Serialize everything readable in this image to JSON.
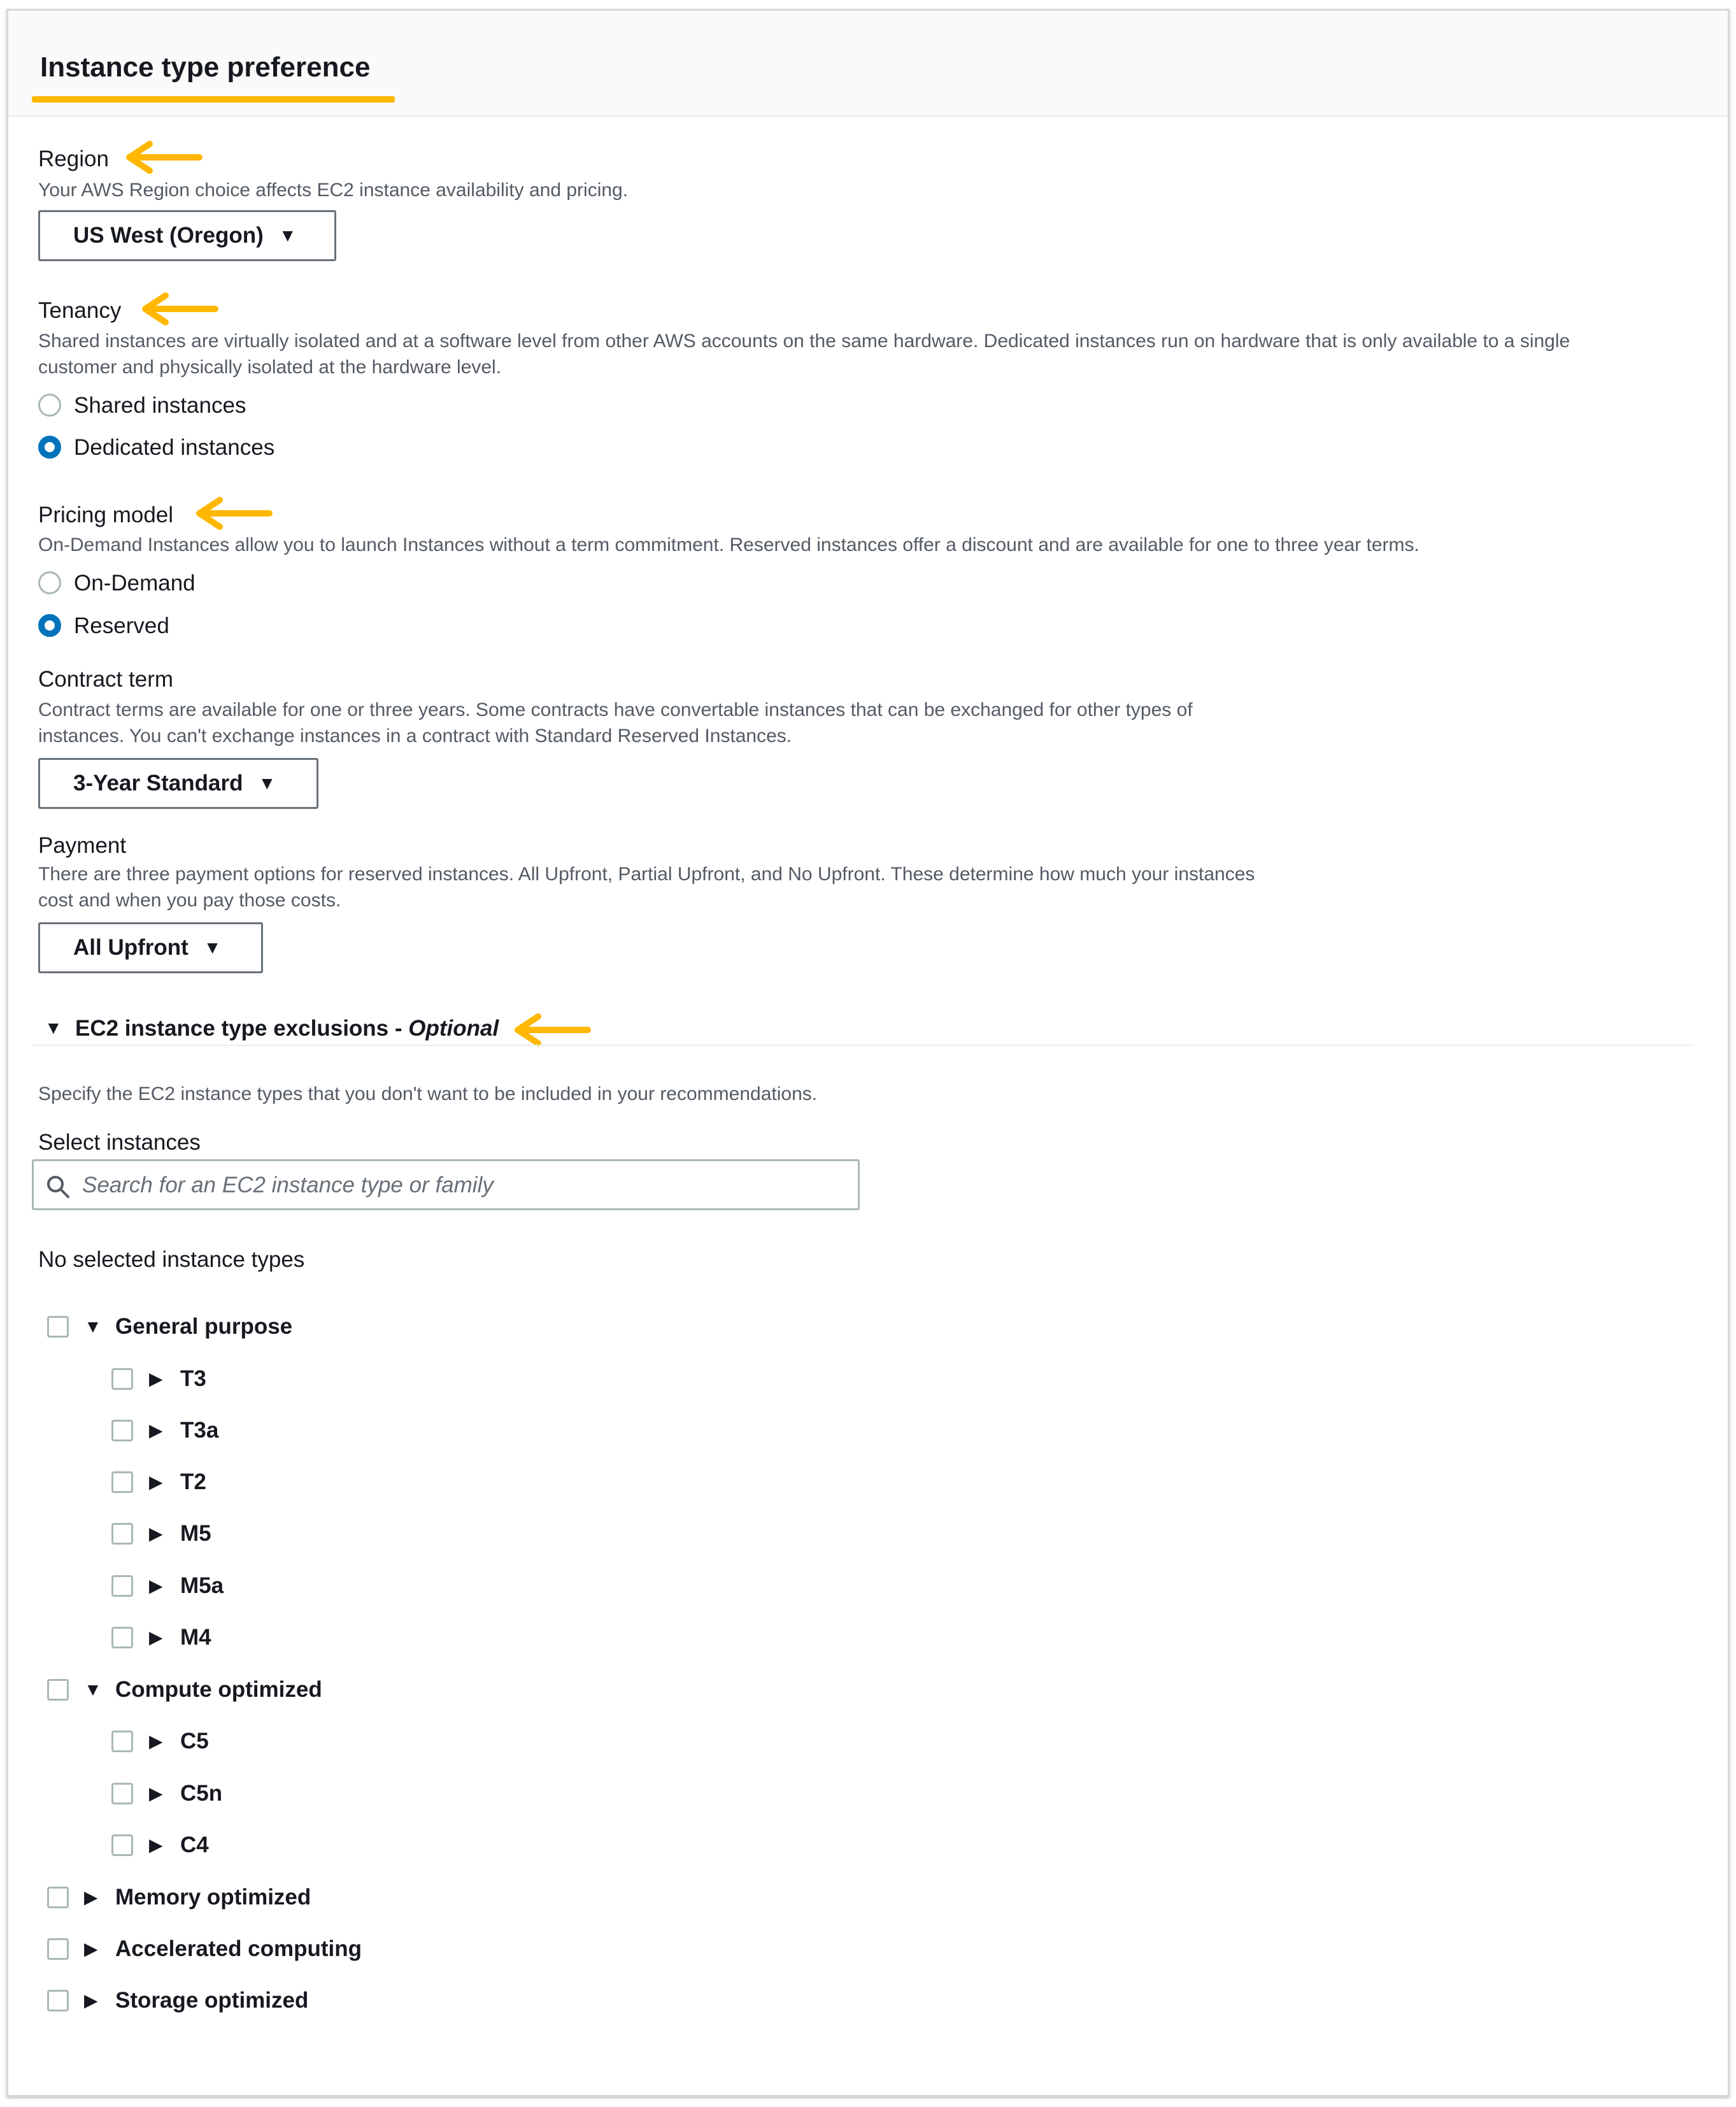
{
  "panel": {
    "title": "Instance type preference"
  },
  "region": {
    "label": "Region",
    "description": "Your AWS Region choice affects EC2 instance availability and pricing.",
    "selected": "US West (Oregon)"
  },
  "tenancy": {
    "label": "Tenancy",
    "description": "Shared instances are virtually isolated and at a software level from other AWS accounts on the same hardware. Dedicated instances run on hardware that is only available to a single customer and physically isolated at the hardware level.",
    "options": [
      {
        "label": "Shared instances",
        "selected": false
      },
      {
        "label": "Dedicated instances",
        "selected": true
      }
    ]
  },
  "pricing": {
    "label": "Pricing model",
    "description": "On-Demand Instances allow you to launch Instances without a term commitment. Reserved instances offer a discount and are available for one to three year terms.",
    "options": [
      {
        "label": "On-Demand",
        "selected": false
      },
      {
        "label": "Reserved",
        "selected": true
      }
    ]
  },
  "contract": {
    "label": "Contract term",
    "description": "Contract terms are available for one or three years. Some contracts have convertable instances that can be exchanged for other types of instances. You can't exchange instances in a contract with Standard Reserved Instances.",
    "selected": "3-Year Standard"
  },
  "payment": {
    "label": "Payment",
    "description": "There are three payment options for reserved instances. All Upfront, Partial Upfront, and No Upfront. These determine how much your instances cost and when you pay those costs.",
    "selected": "All Upfront"
  },
  "exclusions": {
    "title": "EC2 instance type exclusions -",
    "optional": "Optional",
    "description": "Specify the EC2 instance types that you don't want to be included in your recommendations.",
    "select_label": "Select instances",
    "search_placeholder": "Search for an EC2 instance type or family",
    "none_selected": "No selected instance types",
    "tree": [
      {
        "label": "General purpose",
        "expanded": true,
        "children": [
          "T3",
          "T3a",
          "T2",
          "M5",
          "M5a",
          "M4"
        ]
      },
      {
        "label": "Compute optimized",
        "expanded": true,
        "children": [
          "C5",
          "C5n",
          "C4"
        ]
      },
      {
        "label": "Memory optimized",
        "expanded": false,
        "children": []
      },
      {
        "label": "Accelerated computing",
        "expanded": false,
        "children": []
      },
      {
        "label": "Storage optimized",
        "expanded": false,
        "children": []
      }
    ]
  },
  "colors": {
    "annotation": "#ffb700",
    "radio_selected": "#0073bb",
    "text": "#16191f",
    "muted": "#545b64"
  },
  "icons": {
    "dropdown": "caret-down-icon",
    "expanded": "triangle-down-icon",
    "collapsed": "triangle-right-icon",
    "search": "search-icon",
    "annotation": "arrow-left-icon"
  }
}
